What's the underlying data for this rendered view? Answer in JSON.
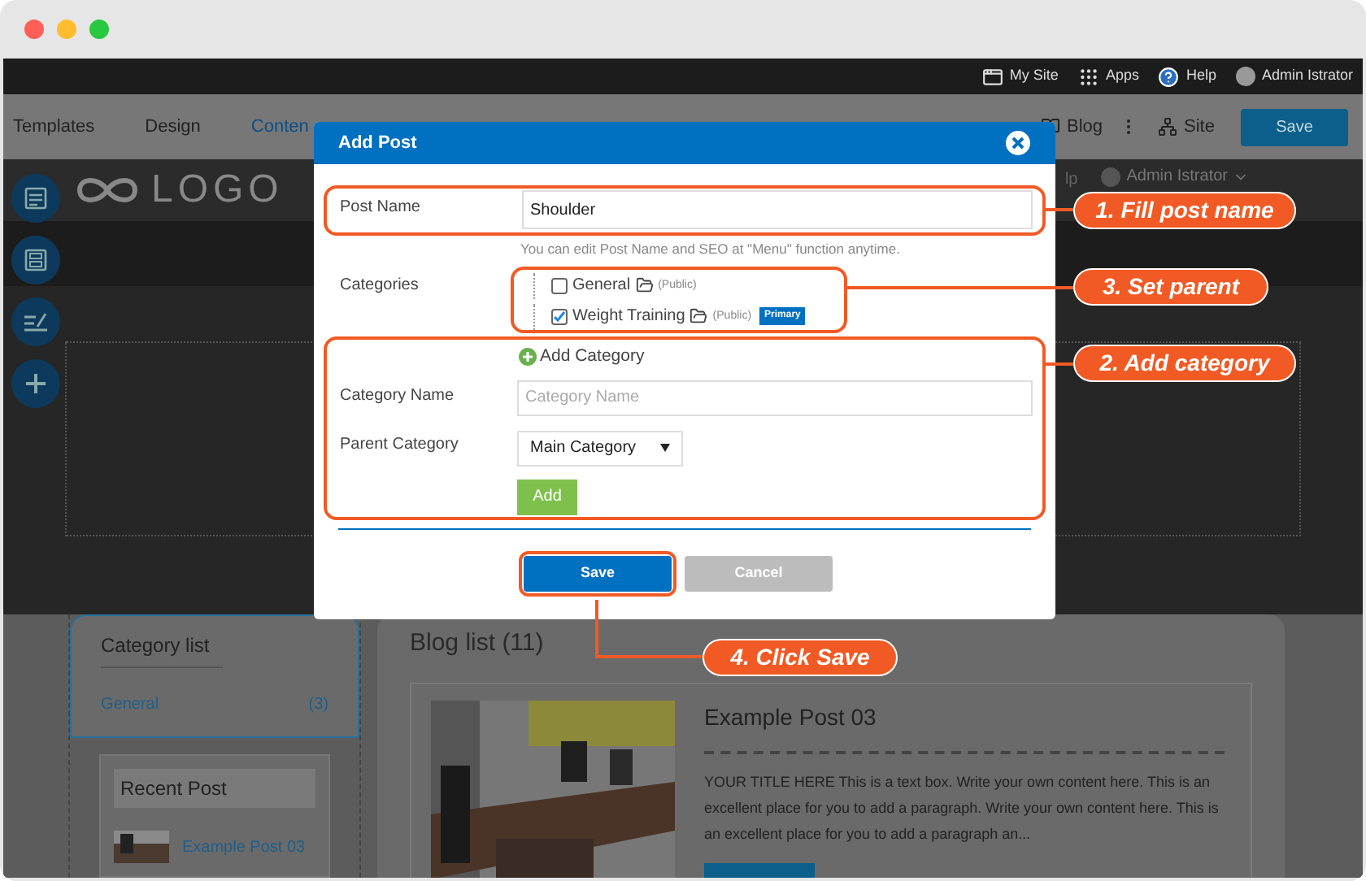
{
  "top_bar": {
    "items": [
      {
        "kind": "site",
        "label": "My Site"
      },
      {
        "kind": "apps",
        "label": "Apps"
      },
      {
        "kind": "help",
        "label": "Help"
      },
      {
        "kind": "user",
        "label": "Admin Istrator"
      }
    ]
  },
  "toolbar": {
    "tabs": [
      {
        "label": "Templates",
        "selected": false
      },
      {
        "label": "Design",
        "selected": false
      },
      {
        "label": "Conten",
        "selected": true
      }
    ],
    "right": [
      {
        "kind": "blog",
        "label": "Blog"
      },
      {
        "kind": "site",
        "label": "Site"
      }
    ],
    "save": "Save"
  },
  "header": {
    "logo": "LOGO",
    "help_fragment": "lp",
    "user": "Admin Istrator"
  },
  "category_list": {
    "title": "Category list",
    "items": [
      {
        "label": "General",
        "count": "(3)"
      }
    ]
  },
  "recent_post": {
    "title": "Recent Post",
    "items": [
      {
        "label": "Example Post 03"
      }
    ]
  },
  "blog_list": {
    "title": "Blog list (11)",
    "posts": [
      {
        "title": "Example Post 03",
        "excerpt": "YOUR TITLE HERE This is a text box. Write your own content here. This is an excellent place for you to add a paragraph. Write your own content here. This is an excellent place for you to add a paragraph an..."
      }
    ]
  },
  "dialog": {
    "title": "Add Post",
    "post_name_label": "Post Name",
    "post_name_value": "Shoulder",
    "hint": "You can edit Post Name and SEO at \"Menu\" function anytime.",
    "categories_label": "Categories",
    "categories": [
      {
        "label": "General",
        "visibility": "(Public)",
        "checked": false
      },
      {
        "label": "Weight Training",
        "visibility": "(Public)",
        "checked": true,
        "badge": "Primary"
      }
    ],
    "add_category": "Add Category",
    "category_name_label": "Category Name",
    "category_name_placeholder": "Category Name",
    "parent_category_label": "Parent Category",
    "parent_category_value": "Main Category",
    "add_button": "Add",
    "save": "Save",
    "cancel": "Cancel"
  },
  "callouts": [
    {
      "label": "1. Fill post name"
    },
    {
      "label": "3. Set parent"
    },
    {
      "label": "2. Add category"
    },
    {
      "label": "4. Click Save"
    }
  ]
}
